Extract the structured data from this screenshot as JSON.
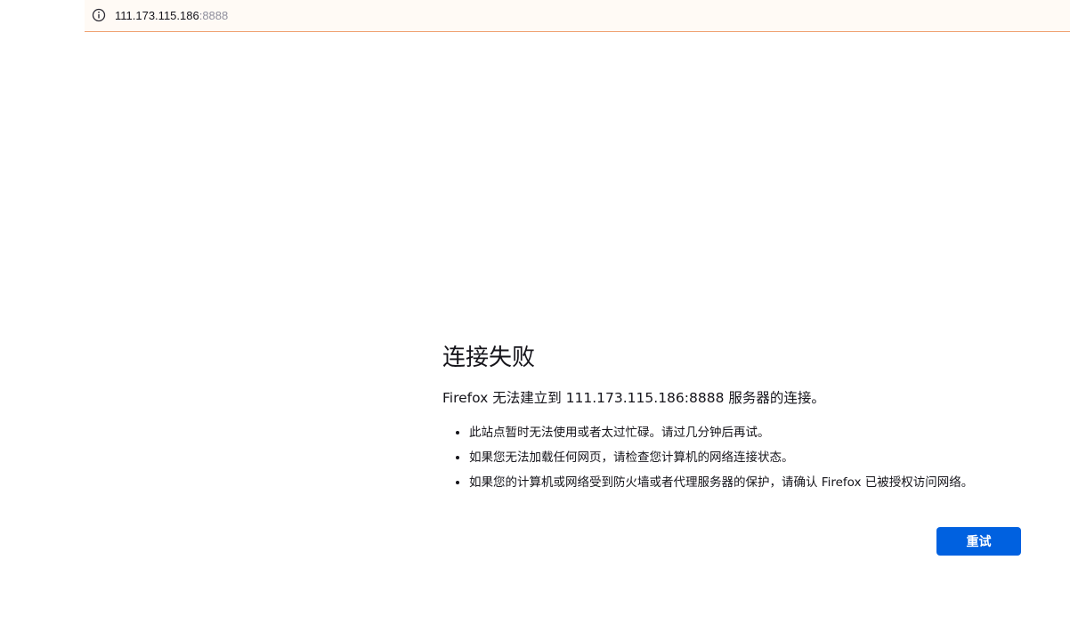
{
  "urlbar": {
    "host": "111.173.115.186",
    "port": ":8888",
    "icon": "info-icon"
  },
  "error": {
    "title": "连接失败",
    "description": "Firefox 无法建立到 111.173.115.186:8888 服务器的连接。",
    "items": [
      "此站点暂时无法使用或者太过忙碌。请过几分钟后再试。",
      "如果您无法加载任何网页，请检查您计算机的网络连接状态。",
      "如果您的计算机或网络受到防火墙或者代理服务器的保护，请确认 Firefox 已被授权访问网络。"
    ],
    "retry_label": "重试"
  },
  "colors": {
    "accent": "#0061e0",
    "urlbar_border": "#f0a070",
    "text": "#15141a"
  }
}
